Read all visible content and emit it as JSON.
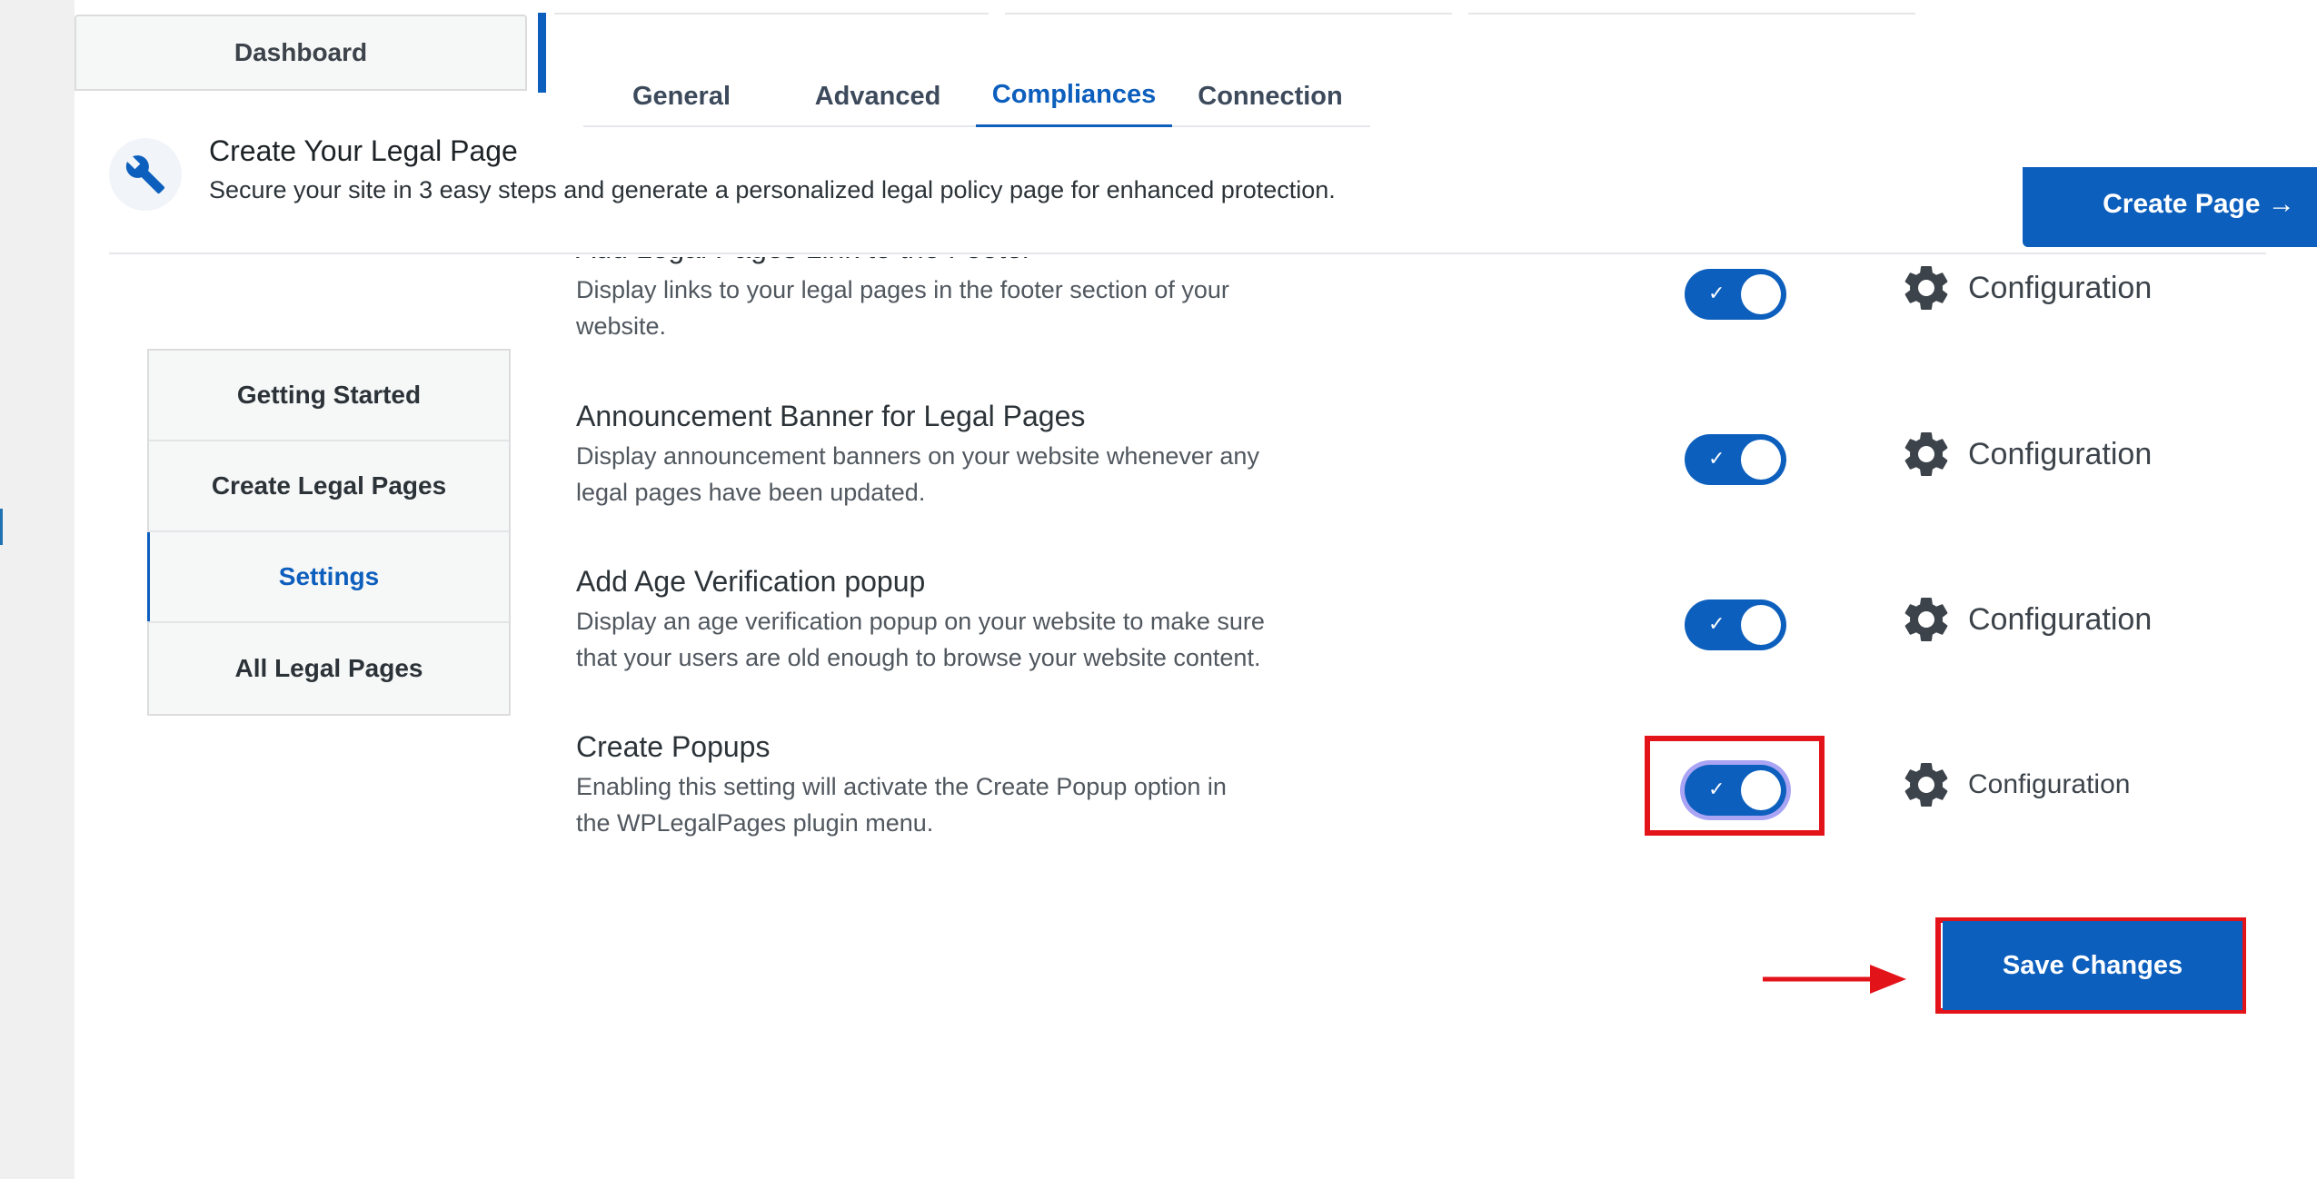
{
  "header": {
    "dashboard_label": "Dashboard",
    "tabs": [
      {
        "label": "General",
        "active": false
      },
      {
        "label": "Advanced",
        "active": false
      },
      {
        "label": "Compliances",
        "active": true
      },
      {
        "label": "Connection",
        "active": false
      }
    ]
  },
  "banner": {
    "icon": "wrench-icon",
    "title": "Create Your Legal Page",
    "description": "Secure your site in 3 easy steps and generate a personalized legal policy page for enhanced protection.",
    "button_label": "Create Page →"
  },
  "sidebar": {
    "items": [
      {
        "label": "Getting Started",
        "active": false
      },
      {
        "label": "Create Legal Pages",
        "active": false
      },
      {
        "label": "Settings",
        "active": true
      },
      {
        "label": "All Legal Pages",
        "active": false
      }
    ]
  },
  "settings": {
    "rows": [
      {
        "title": "Add Legal Pages Link to the Footer",
        "description": "Display links to your legal pages in the footer section of your website.",
        "enabled": true,
        "config_label": "Configuration"
      },
      {
        "title": "Announcement Banner for Legal Pages",
        "description": "Display announcement banners on your website whenever any legal pages have been updated.",
        "enabled": true,
        "config_label": "Configuration"
      },
      {
        "title": "Add Age Verification popup",
        "description": "Display an age verification popup on your website to make sure that your users are old enough to browse your website content.",
        "enabled": true,
        "config_label": "Configuration"
      },
      {
        "title": "Create Popups",
        "description": "Enabling this setting will activate the Create Popup option in the WPLegalPages plugin menu.",
        "enabled": true,
        "config_label": "Configuration"
      }
    ],
    "toggle_check": "✓"
  },
  "save_label": "Save Changes",
  "colors": {
    "primary": "#0d5fbd",
    "highlight": "#e3131a",
    "focus_ring": "#a9a4f4"
  }
}
